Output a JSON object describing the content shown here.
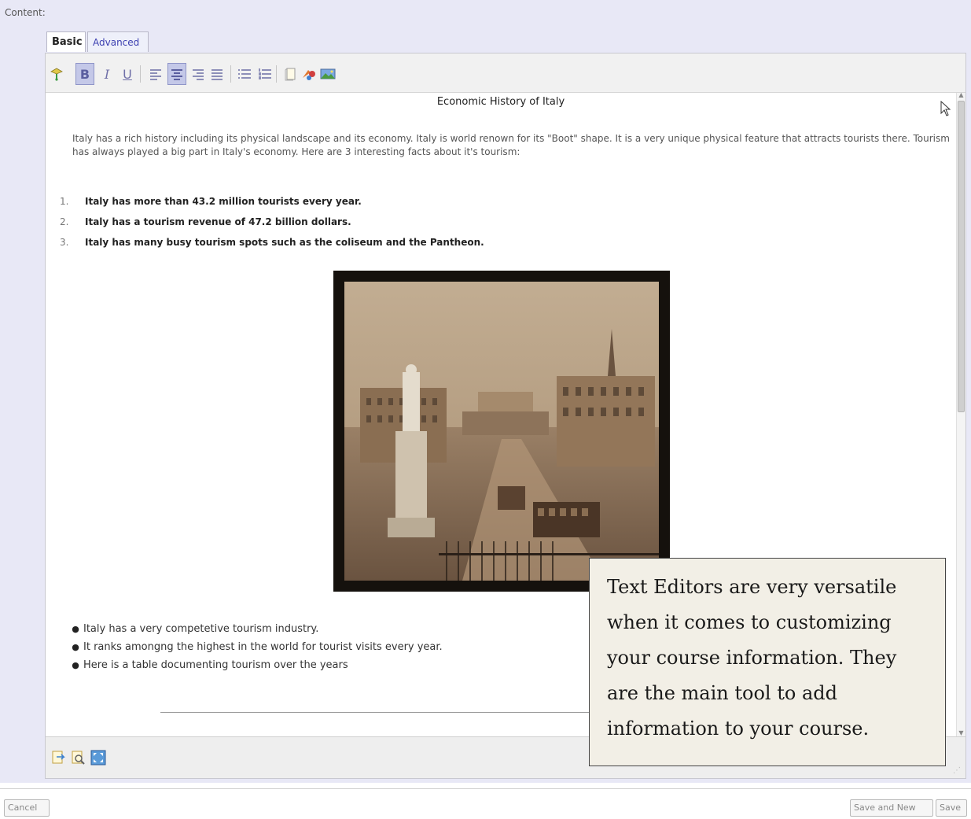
{
  "content_label": "Content:",
  "tabs": [
    {
      "label": "Basic",
      "active": true
    },
    {
      "label": "Advanced",
      "active": false
    }
  ],
  "toolbar": {
    "tools": [
      "paint-icon",
      "bold-icon",
      "italic-icon",
      "underline-icon",
      "align-left-icon",
      "align-center-icon",
      "align-right-icon",
      "justify-icon",
      "bulleted-list-icon",
      "numbered-list-icon",
      "insert-file-icon",
      "insert-link-icon",
      "insert-image-icon"
    ],
    "bold": "B",
    "italic": "I",
    "underline": "U",
    "active_tools": [
      "bold",
      "align-center"
    ]
  },
  "document": {
    "title": "Economic History of Italy",
    "intro": "Italy has a rich history including its physical landscape and its economy. Italy is world renown for its \"Boot\" shape. It is a very unique physical feature that attracts tourists there. Tourism has always played a big part in Italy's economy. Here are 3 interesting facts about it's tourism:",
    "facts": [
      {
        "num": "1.",
        "text": "Italy has more than 43.2 million tourists every year."
      },
      {
        "num": "2.",
        "text": "Italy has a  tourism revenue of 47.2 billion dollars."
      },
      {
        "num": "3.",
        "text": "Italy has many busy tourism spots such as the coliseum and the Pantheon."
      }
    ],
    "bullets": [
      "Italy has a very competetive tourism industry.",
      "It ranks amongng the highest in the world for tourist visits every year.",
      "Here is a table documenting tourism over the years"
    ]
  },
  "statusbar": {
    "tools": [
      "preview-icon",
      "find-icon",
      "fullscreen-icon"
    ]
  },
  "buttons": {
    "cancel": "Cancel",
    "save_and_new": "Save and New",
    "save": "Save"
  },
  "callout": {
    "text": "Text Editors are very versatile when it comes to customizing your course information. They are the main tool to add information to your course."
  },
  "colors": {
    "panel_bg": "#e8e8f6",
    "tab_advanced_text": "#3b3fb0",
    "toolbar_active": "#c4c8e8",
    "callout_bg": "#f2efe6"
  }
}
